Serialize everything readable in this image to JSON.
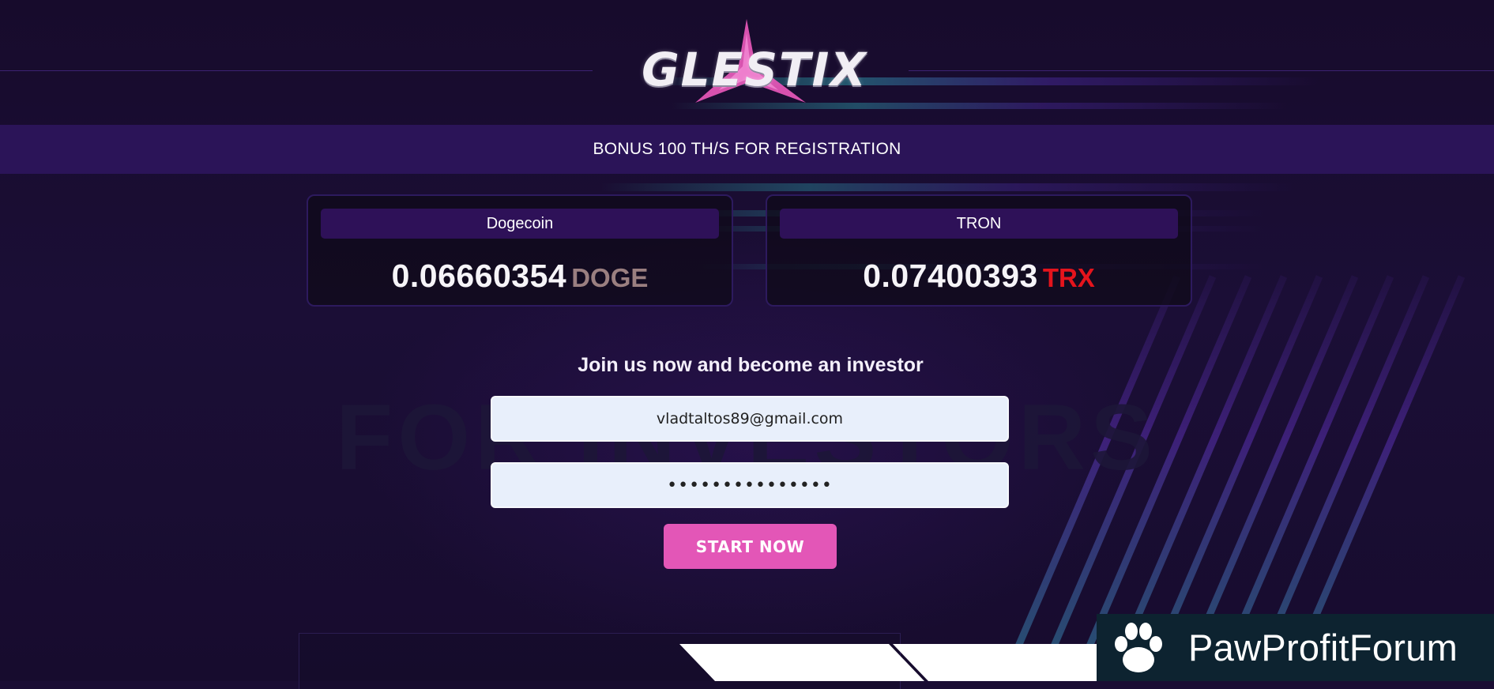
{
  "header": {
    "logo_text": "GLESTIX"
  },
  "bonus_bar": {
    "text": "BONUS 100 TH/S FOR REGISTRATION"
  },
  "coins": [
    {
      "name": "Dogecoin",
      "value": "0.06660354",
      "symbol": "DOGE",
      "symbol_color": "#9a7f80"
    },
    {
      "name": "TRON",
      "value": "0.07400393",
      "symbol": "TRX",
      "symbol_color": "#e4141c"
    }
  ],
  "watermark_text": "FOR INVESTORS",
  "join": {
    "title": "Join us now and become an investor",
    "email_value": "vladtaltos89@gmail.com",
    "password_value": "•••••••••••••••",
    "button_label": "START NOW"
  },
  "forum_badge": {
    "text": "PawProfitForum",
    "icon": "paw-icon"
  },
  "colors": {
    "background": "#1a0d33",
    "bonus_bar": "#2b1458",
    "button": "#e356b7",
    "accent_pink": "#e356b7"
  }
}
